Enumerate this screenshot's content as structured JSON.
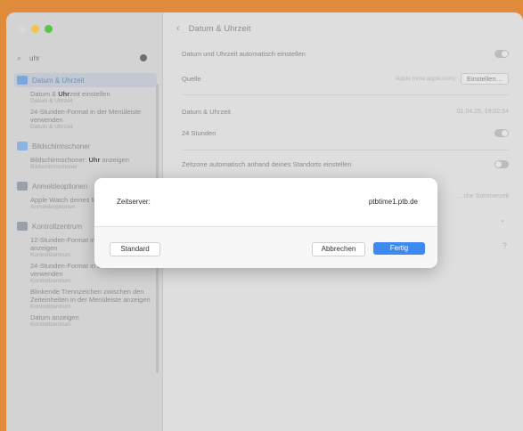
{
  "search": {
    "value": "uhr"
  },
  "sidebar": {
    "results": [
      {
        "label": "Datum & Uhrzeit",
        "active": true,
        "icon_color": "#7da7da",
        "subs": [
          {
            "pre": "Datum & ",
            "bold": "Uhr",
            "post": "zeit einstellen",
            "path": "Datum & Uhrzeit"
          },
          {
            "pre": "24-Stunden-Format in der Menüleiste verwenden",
            "bold": "",
            "post": "",
            "path": "Datum & Uhrzeit"
          }
        ]
      },
      {
        "label": "Bildschirmschoner",
        "active": false,
        "icon_color": "#8db3e0",
        "subs": [
          {
            "pre": "Bildschirmschoner: ",
            "bold": "Uhr",
            "post": " anzeigen",
            "path": "Bildschirmschoner"
          }
        ]
      },
      {
        "label": "Anmeldeoptionen",
        "active": false,
        "icon_color": "#9aa0a8",
        "subs": [
          {
            "pre": "Apple Watch deines Mac alle…",
            "bold": "",
            "post": "",
            "path": "Anmeldeoptionen"
          }
        ]
      },
      {
        "label": "Kontrollzentrum",
        "active": false,
        "icon_color": "#9aa0a8",
        "subs": [
          {
            "pre": "12-Stunden-Format in der Menüleiste anzeigen",
            "bold": "",
            "post": "",
            "path": "Kontrollzentrum"
          },
          {
            "pre": "24-Stunden-Format in der Menüleiste verwenden",
            "bold": "",
            "post": "",
            "path": "Kontrollzentrum"
          },
          {
            "pre": "Blinkende Trennzeichen zwischen den Zeiteinheiten in der Menüleiste anzeigen",
            "bold": "",
            "post": "",
            "path": "Kontrollzentrum"
          },
          {
            "pre": "Datum anzeigen",
            "bold": "",
            "post": "",
            "path": "Kontrollzentrum"
          }
        ]
      }
    ]
  },
  "main": {
    "title": "Datum & Uhrzeit",
    "auto_time_label": "Datum und Uhrzeit automatisch einstellen",
    "source_label": "Quelle",
    "source_value": "Apple (time.apple.com)",
    "set_button": "Einstellen…",
    "date_time_label": "Datum & Uhrzeit",
    "date_time_value": "01.04.25, 19:02:54",
    "h24_label": "24 Stunden",
    "tz_label": "Zeitzone automatisch anhand deines Standorts einstellen",
    "partial_right": "…che Sommerzeit"
  },
  "dialog": {
    "server_label": "Zeitserver:",
    "server_value": "ptbtime1.ptb.de",
    "standard_button": "Standard",
    "cancel_button": "Abbrechen",
    "done_button": "Fertig"
  }
}
